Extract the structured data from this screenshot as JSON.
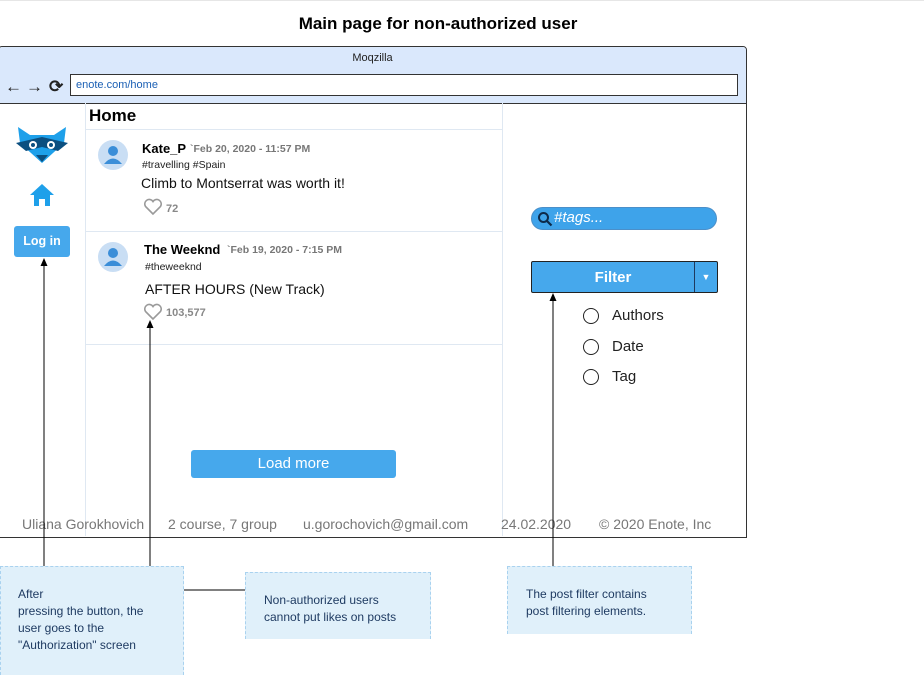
{
  "page": {
    "title": "Main page for non-authorized user"
  },
  "browser": {
    "name": "Moqzilla",
    "url": "enote.com/home"
  },
  "nav": {
    "back_icon": "←",
    "forward_icon": "→",
    "reload_icon": "⟳"
  },
  "sidebar": {
    "login_label": "Log in"
  },
  "main": {
    "title": "Home",
    "posts": [
      {
        "author": "Kate_P",
        "date": "`Feb 20, 2020 - 11:57 PM",
        "tags": "#travelling #Spain",
        "text": "Climb to Montserrat was worth it!",
        "likes": "72"
      },
      {
        "author": "The Weeknd",
        "date": "`Feb 19, 2020 - 7:15 PM",
        "tags": "#theweeknd",
        "text": "AFTER HOURS (New Track)",
        "likes": "103,577"
      }
    ],
    "load_more_label": "Load more"
  },
  "filter_panel": {
    "search_placeholder": "#tags...",
    "filter_label": "Filter",
    "options": [
      "Authors",
      "Date",
      "Tag"
    ]
  },
  "footer": {
    "author": "Uliana Gorokhovich",
    "group": "2 course, 7 group",
    "email": "u.gorochovich@gmail.com",
    "date": "24.02.2020",
    "copyright": "© 2020 Enote, Inc"
  },
  "notes": {
    "login": [
      "After",
      "pressing the button, the",
      "user goes to the",
      "\"Authorization\" screen"
    ],
    "likes": [
      "Non-authorized users",
      "cannot put likes on posts"
    ],
    "filter": [
      "The post filter contains",
      "post filtering elements."
    ]
  },
  "colors": {
    "accent": "#46a8ec",
    "browser_bar": "#dae8fc",
    "note_bg": "#e0f0fa"
  }
}
